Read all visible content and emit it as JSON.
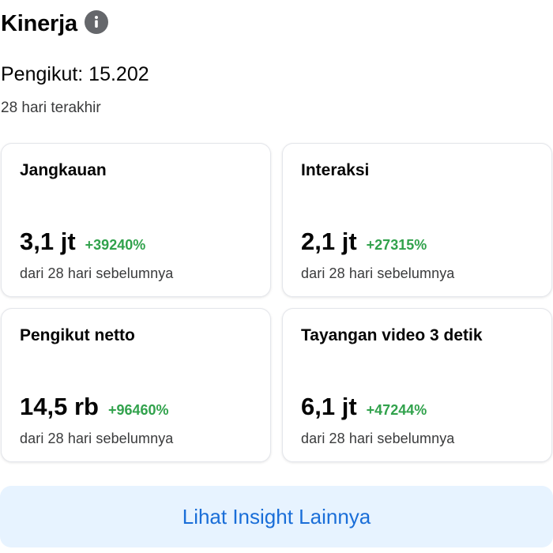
{
  "header": {
    "title": "Kinerja",
    "info_icon": "info-icon"
  },
  "followers": {
    "text": "Pengikut: 15.202"
  },
  "period": "28 hari terakhir",
  "colors": {
    "positive": "#31a24c",
    "accent": "#1a6ed8",
    "cta_background": "#e7f3ff"
  },
  "cards": [
    {
      "title": "Jangkauan",
      "value": "3,1 jt",
      "change": "+39240%",
      "comparison": "dari 28 hari sebelumnya"
    },
    {
      "title": "Interaksi",
      "value": "2,1 jt",
      "change": "+27315%",
      "comparison": "dari 28 hari sebelumnya"
    },
    {
      "title": "Pengikut netto",
      "value": "14,5 rb",
      "change": "+96460%",
      "comparison": "dari 28 hari sebelumnya"
    },
    {
      "title": "Tayangan video 3 detik",
      "value": "6,1 jt",
      "change": "+47244%",
      "comparison": "dari 28 hari sebelumnya"
    }
  ],
  "cta": {
    "label": "Lihat Insight Lainnya"
  }
}
